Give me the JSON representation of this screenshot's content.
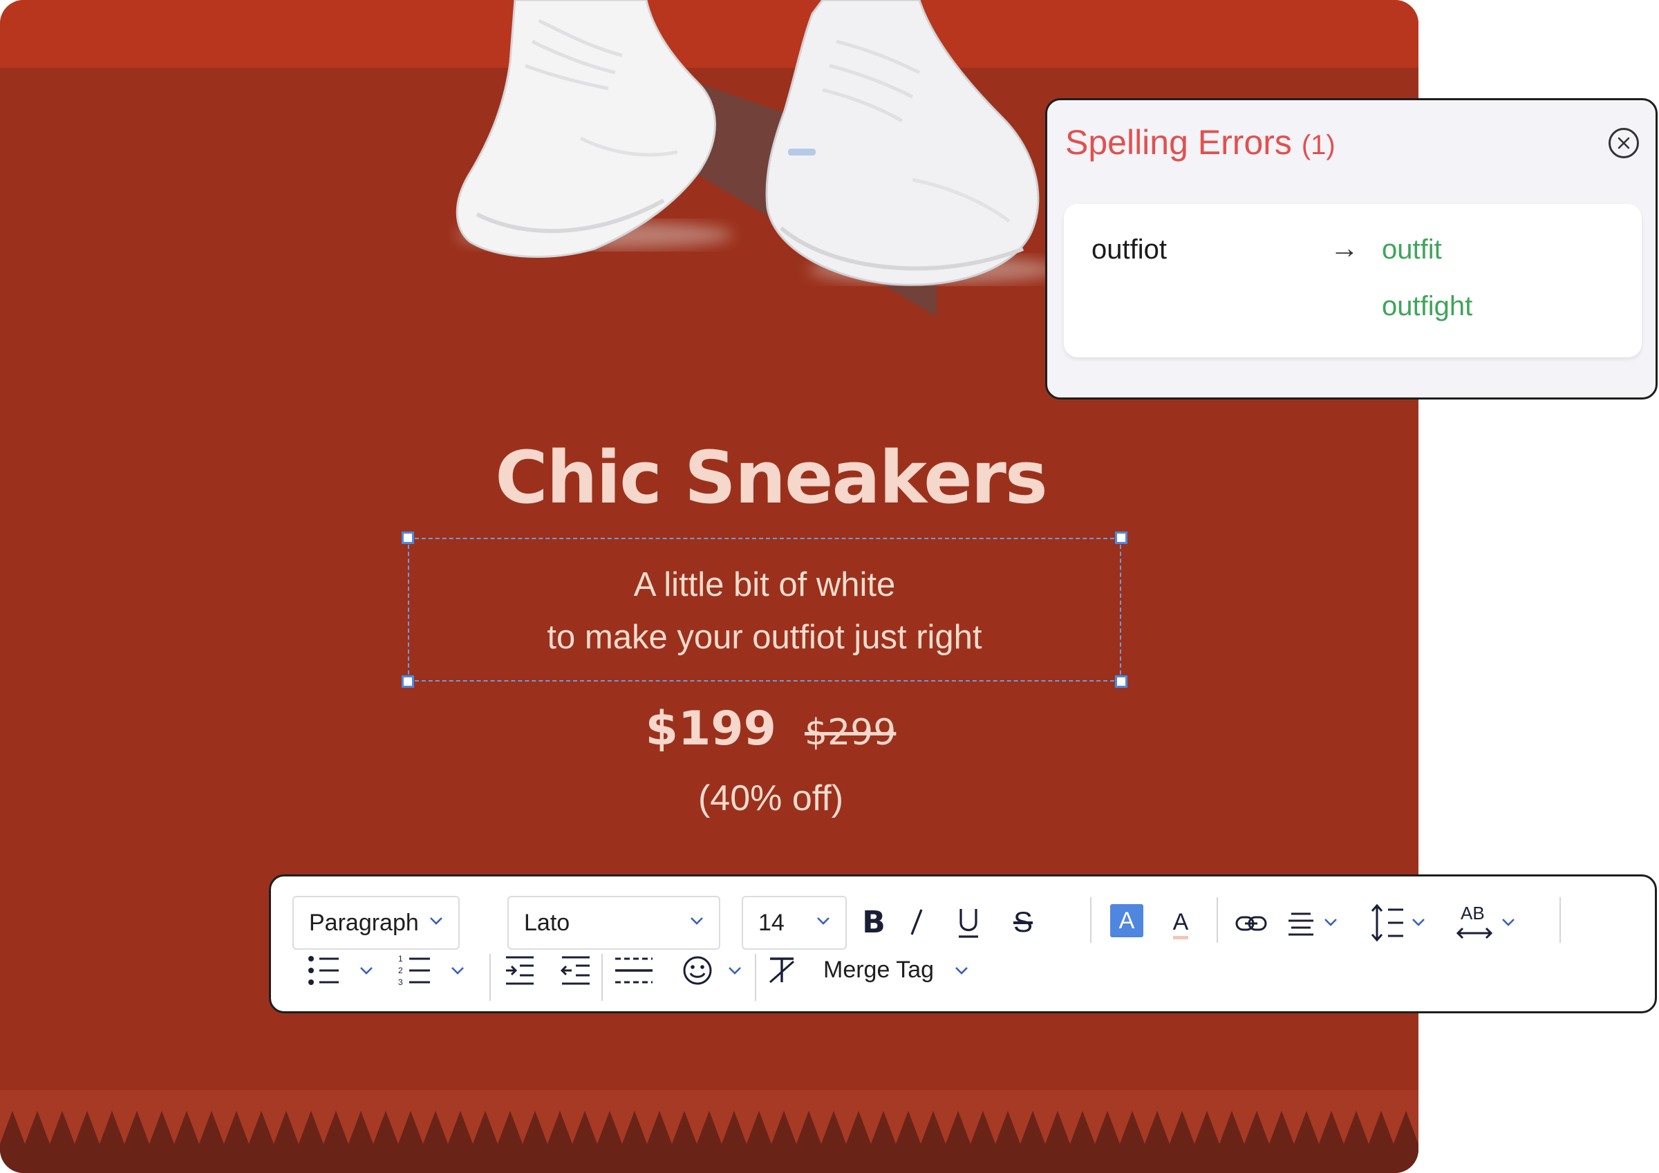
{
  "email": {
    "headline": "Chic Sneakers",
    "subtitle_line1": "A little bit of white",
    "subtitle_line2": "to make your outfiot just right",
    "price": "$199",
    "original_price": "$299",
    "discount": "(40% off)"
  },
  "spelling_panel": {
    "title": "Spelling Errors",
    "count": "(1)",
    "misspelled_word": "outfiot",
    "suggestions": [
      "outfit",
      "outfight"
    ]
  },
  "toolbar": {
    "block_format": "Paragraph",
    "font_family": "Lato",
    "font_size": "14",
    "merge_tag_label": "Merge Tag"
  },
  "icons": {
    "bold": "bold-icon",
    "italic": "italic-icon",
    "underline": "underline-icon",
    "strike": "strikethrough-icon",
    "highlight": "highlight-color-icon",
    "text_color": "text-color-icon",
    "link": "link-icon",
    "align": "align-center-icon",
    "line_height": "line-height-icon",
    "letter_spacing": "letter-spacing-icon",
    "bullet_list": "bullet-list-icon",
    "numbered_list": "numbered-list-icon",
    "indent": "indent-icon",
    "outdent": "outdent-icon",
    "divider": "horizontal-rule-icon",
    "emoji": "emoji-icon",
    "clear_format": "clear-format-icon"
  },
  "colors": {
    "canvas": "#9b311c",
    "accent_text": "#f6d7cb",
    "error_title": "#e0514e",
    "suggestion": "#3ea55a",
    "selection": "#4d89e3",
    "highlight_swatch": "#4f86e0"
  }
}
